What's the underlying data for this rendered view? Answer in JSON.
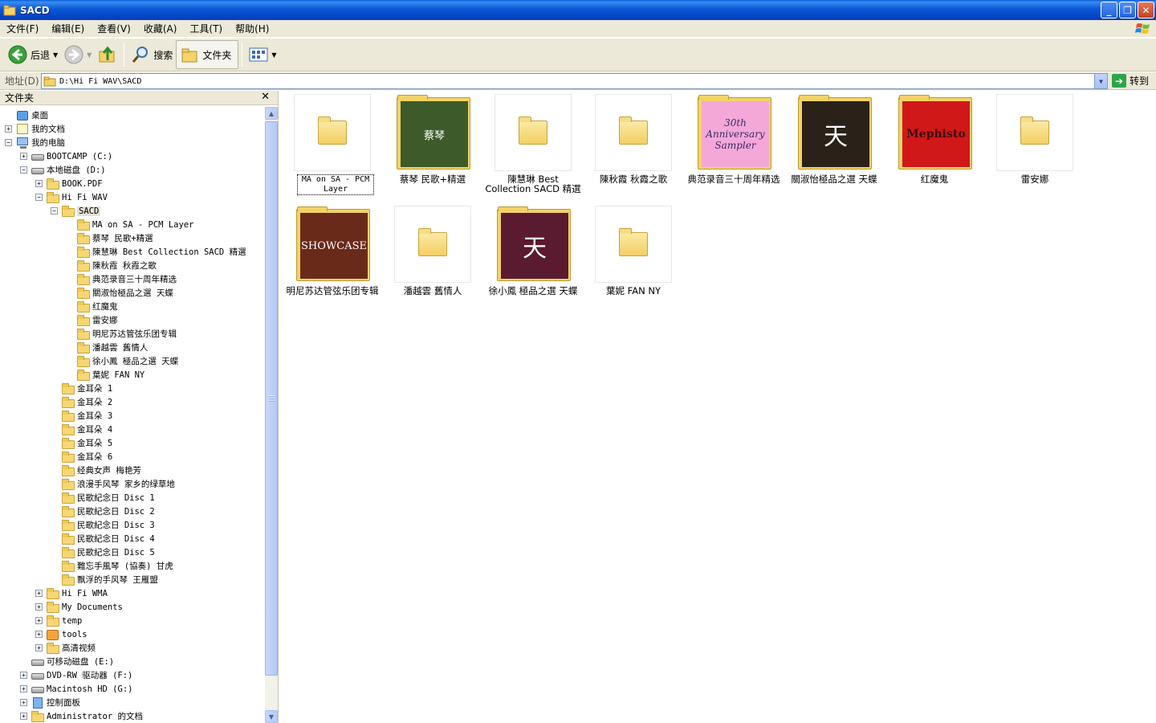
{
  "window": {
    "title": "SACD",
    "icon": "explorer-folder-icon",
    "controls": {
      "minimize": "_",
      "maximize": "❐",
      "close": "✕"
    }
  },
  "menu": [
    "文件(F)",
    "编辑(E)",
    "查看(V)",
    "收藏(A)",
    "工具(T)",
    "帮助(H)"
  ],
  "toolbar": {
    "back_label": "后退",
    "search_label": "搜索",
    "folders_label": "文件夹"
  },
  "address": {
    "label": "地址(D)",
    "value": "D:\\Hi Fi WAV\\SACD",
    "go_label": "转到"
  },
  "folder_pane": {
    "title": "文件夹",
    "close": "✕",
    "tree": [
      {
        "label": "桌面",
        "icon": "desktop",
        "expander": ""
      },
      {
        "label": "我的文档",
        "icon": "documents",
        "expander": "+"
      },
      {
        "label": "我的电脑",
        "icon": "computer",
        "expander": "−"
      },
      {
        "label": "BOOTCAMP (C:)",
        "icon": "drive",
        "expander": "+"
      },
      {
        "label": "本地磁盘 (D:)",
        "icon": "drive",
        "expander": "−"
      },
      {
        "label": "BOOK.PDF",
        "icon": "folder",
        "expander": "+"
      },
      {
        "label": "Hi Fi WAV",
        "icon": "folder",
        "expander": "−"
      },
      {
        "label": "SACD",
        "icon": "folder-open",
        "expander": "−"
      },
      {
        "label": "MA on SA - PCM Layer",
        "icon": "folder",
        "expander": ""
      },
      {
        "label": "蔡琴 民歌+精選",
        "icon": "folder",
        "expander": ""
      },
      {
        "label": "陳慧琳 Best Collection SACD 精選",
        "icon": "folder",
        "expander": ""
      },
      {
        "label": "陳秋霞 秋霞之歌",
        "icon": "folder",
        "expander": ""
      },
      {
        "label": "典范录音三十周年精选",
        "icon": "folder",
        "expander": ""
      },
      {
        "label": "關淑怡極品之選 天蝶",
        "icon": "folder",
        "expander": ""
      },
      {
        "label": "红魔鬼",
        "icon": "folder",
        "expander": ""
      },
      {
        "label": "雷安娜",
        "icon": "folder",
        "expander": ""
      },
      {
        "label": "明尼苏达管弦乐团专辑",
        "icon": "folder",
        "expander": ""
      },
      {
        "label": "潘越雲 舊情人",
        "icon": "folder",
        "expander": ""
      },
      {
        "label": "徐小鳳 極品之選 天蝶",
        "icon": "folder",
        "expander": ""
      },
      {
        "label": "葉妮 FAN NY",
        "icon": "folder",
        "expander": ""
      },
      {
        "label": "金耳朵 1",
        "icon": "folder",
        "expander": ""
      },
      {
        "label": "金耳朵 2",
        "icon": "folder",
        "expander": ""
      },
      {
        "label": "金耳朵 3",
        "icon": "folder",
        "expander": ""
      },
      {
        "label": "金耳朵 4",
        "icon": "folder",
        "expander": ""
      },
      {
        "label": "金耳朵 5",
        "icon": "folder",
        "expander": ""
      },
      {
        "label": "金耳朵 6",
        "icon": "folder",
        "expander": ""
      },
      {
        "label": "经典女声 梅艳芳",
        "icon": "folder",
        "expander": ""
      },
      {
        "label": "浪漫手风琴 家乡的绿草地",
        "icon": "folder",
        "expander": ""
      },
      {
        "label": "民歌紀念日 Disc 1",
        "icon": "folder",
        "expander": ""
      },
      {
        "label": "民歌紀念日 Disc 2",
        "icon": "folder",
        "expander": ""
      },
      {
        "label": "民歌紀念日 Disc 3",
        "icon": "folder",
        "expander": ""
      },
      {
        "label": "民歌紀念日 Disc 4",
        "icon": "folder",
        "expander": ""
      },
      {
        "label": "民歌紀念日 Disc 5",
        "icon": "folder",
        "expander": ""
      },
      {
        "label": "難忘手風琴 (協奏) 甘虎",
        "icon": "folder",
        "expander": ""
      },
      {
        "label": "飘浮的手风琴 王雁盟",
        "icon": "folder",
        "expander": ""
      },
      {
        "label": "Hi Fi WMA",
        "icon": "folder",
        "expander": "+"
      },
      {
        "label": "My Documents",
        "icon": "folder",
        "expander": "+"
      },
      {
        "label": "temp",
        "icon": "folder",
        "expander": "+"
      },
      {
        "label": "tools",
        "icon": "tools",
        "expander": "+"
      },
      {
        "label": "高清视频",
        "icon": "folder",
        "expander": "+"
      },
      {
        "label": "可移动磁盘 (E:)",
        "icon": "drive",
        "expander": ""
      },
      {
        "label": "DVD-RW 驱动器 (F:)",
        "icon": "drive",
        "expander": "+"
      },
      {
        "label": "Macintosh HD (G:)",
        "icon": "drive",
        "expander": "+"
      },
      {
        "label": "控制面板",
        "icon": "control-panel",
        "expander": "+"
      },
      {
        "label": "Administrator 的文档",
        "icon": "folder",
        "expander": "+"
      }
    ]
  },
  "thumbnails": [
    {
      "label": "MA on SA - PCM Layer",
      "kind": "folder"
    },
    {
      "label": "蔡琴 民歌+精選",
      "kind": "cover",
      "cover_text": "蔡琴",
      "color": "#3c5a2a"
    },
    {
      "label": "陳慧琳 Best Collection SACD 精選",
      "kind": "folder"
    },
    {
      "label": "陳秋霞 秋霞之歌",
      "kind": "folder"
    },
    {
      "label": "典范录音三十周年精选",
      "kind": "cover",
      "cover_text": "30th Anniversary Sampler",
      "color": "#f3a8d8"
    },
    {
      "label": "關淑怡極品之選 天蝶",
      "kind": "cover",
      "cover_text": "天",
      "color": "#2a2118"
    },
    {
      "label": "红魔鬼",
      "kind": "cover",
      "cover_text": "Mephisto",
      "color": "#d01818"
    },
    {
      "label": "雷安娜",
      "kind": "folder"
    },
    {
      "label": "明尼苏达管弦乐团专辑",
      "kind": "cover",
      "cover_text": "SHOWCASE",
      "color": "#6a2a1a"
    },
    {
      "label": "潘越雲 舊情人",
      "kind": "folder"
    },
    {
      "label": "徐小鳳 極品之選 天蝶",
      "kind": "cover",
      "cover_text": "天",
      "color": "#5a1a30"
    },
    {
      "label": "葉妮 FAN NY",
      "kind": "folder"
    }
  ]
}
